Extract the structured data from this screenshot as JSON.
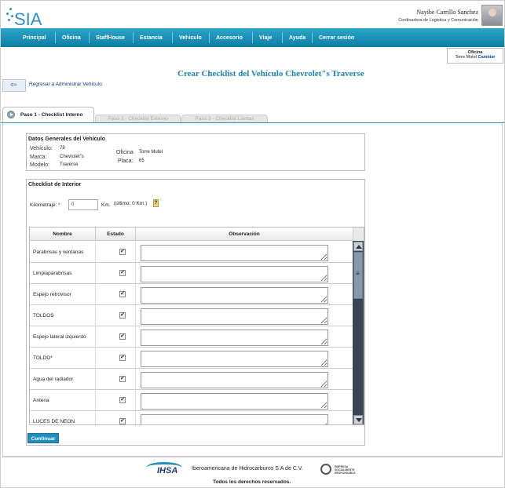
{
  "brand": {
    "logo_text": "SIA"
  },
  "user": {
    "name": "Nayibe Carrillo Sanchez",
    "role": "Cordinadora de Logistica y Comunicación"
  },
  "nav": [
    "Principal",
    "Oficina",
    "StaffHouse",
    "Estancia",
    "Vehiculo",
    "Accesorio",
    "Viaje",
    "Ayuda",
    "Cerrar sesión"
  ],
  "office": {
    "label": "Oficina",
    "name": "Torre Mutel",
    "change": "Cambiar"
  },
  "page_title": "Crear Checklist del Vehículo Chevrolet\"s Traverse",
  "back_link": "Regresar a Administrar Vehiculo",
  "tabs": [
    "Paso 1 - Checklist Interno",
    "Paso 2 - Checklist Externo",
    "Paso 3 - Checklist Llantas"
  ],
  "general": {
    "legend": "Datos Generales del Vehículo",
    "vehiculo_label": "Vehículo:",
    "vehiculo": "78",
    "marca_label": "Marca:",
    "marca": "Chevrolet\"s",
    "modelo_label": "Modelo:",
    "modelo": "Traverse",
    "oficina_label": "Oficina",
    "oficina": "Torre Mutel",
    "placa_label": "Placa:",
    "placa": "65"
  },
  "checklist": {
    "legend": "Checklist de Interior",
    "km_label": "Kilometraje:",
    "km_required": "*",
    "km_value": "0",
    "km_unit": "Km.",
    "km_last": "(último: 0 Km.)",
    "help": "?",
    "columns": {
      "name": "Nombre",
      "status": "Estado",
      "obs": "Observación"
    },
    "rows": [
      "Parabrisas y ventanas",
      "Limpiaparabrisas",
      "Espejo retrovisor",
      "TOLDOS",
      "Espejo lateral izquierdo",
      "TOLDO*",
      "Agua del radiador",
      "Antena",
      "LUCES DE NEON"
    ],
    "check_glyph": "✔"
  },
  "continue_button": "Continuar",
  "footer": {
    "logo_text": "IHSA",
    "company": "Iberoamericana de Hidrocarburos S.A de C.V.",
    "badge": "EMPRESA SOCIALMENTE RESPONSABLE",
    "rights": "Todos los derechos reservados."
  }
}
